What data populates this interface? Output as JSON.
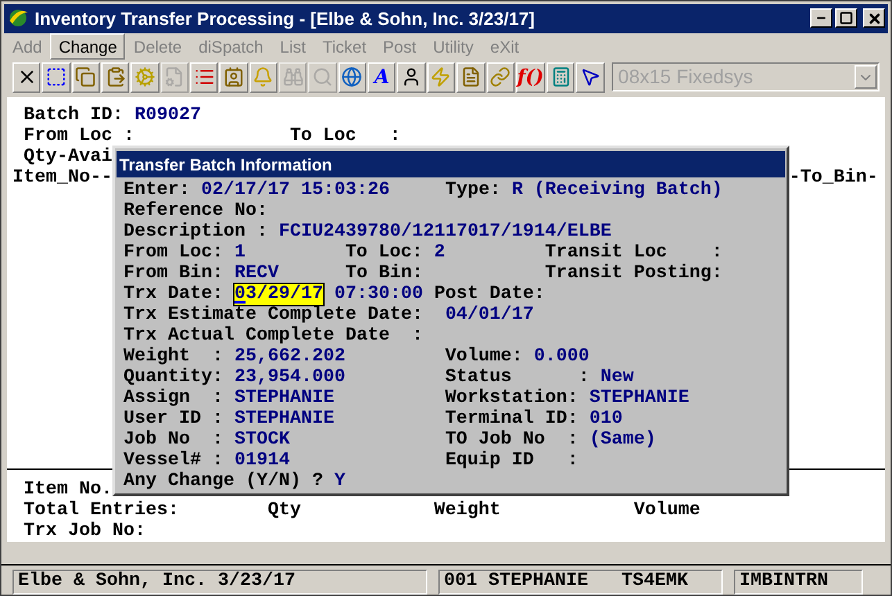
{
  "window": {
    "title": "Inventory Transfer Processing - [Elbe & Sohn, Inc. 3/23/17]"
  },
  "menu": [
    {
      "label": "Add",
      "disabled": true,
      "selected": false
    },
    {
      "label": "Change",
      "disabled": false,
      "selected": true
    },
    {
      "label": "Delete",
      "disabled": true,
      "selected": false
    },
    {
      "label": "diSpatch",
      "disabled": true,
      "selected": false
    },
    {
      "label": "List",
      "disabled": true,
      "selected": false
    },
    {
      "label": "Ticket",
      "disabled": true,
      "selected": false
    },
    {
      "label": "Post",
      "disabled": true,
      "selected": false
    },
    {
      "label": "Utility",
      "disabled": true,
      "selected": false
    },
    {
      "label": "eXit",
      "disabled": true,
      "selected": false
    }
  ],
  "toolbar": {
    "buttons": [
      {
        "kind": "icon",
        "disabled": false
      },
      {
        "kind": "icon",
        "disabled": false
      },
      {
        "kind": "icon",
        "disabled": false
      },
      {
        "kind": "icon",
        "disabled": false
      },
      {
        "kind": "icon",
        "disabled": false
      },
      {
        "kind": "icon",
        "disabled": true
      },
      {
        "kind": "icon",
        "disabled": false
      },
      {
        "kind": "icon",
        "disabled": false
      },
      {
        "kind": "icon",
        "disabled": false
      },
      {
        "kind": "icon",
        "disabled": true
      },
      {
        "kind": "icon",
        "disabled": true
      },
      {
        "kind": "icon",
        "disabled": false
      },
      {
        "kind": "glyph",
        "text": "A",
        "disabled": false
      },
      {
        "kind": "icon",
        "disabled": false
      },
      {
        "kind": "icon",
        "disabled": false
      },
      {
        "kind": "icon",
        "disabled": false
      },
      {
        "kind": "icon",
        "disabled": false
      },
      {
        "kind": "glyph",
        "text": "f()",
        "disabled": false
      },
      {
        "kind": "icon",
        "disabled": false
      },
      {
        "kind": "icon",
        "disabled": false
      }
    ],
    "font_select": {
      "value": "08x15 Fixedsys",
      "disabled": true
    }
  },
  "terminal": {
    "top_lines": [
      [
        {
          "kind": "label",
          "text": "Batch ID:"
        },
        {
          "kind": "value",
          "text": "R09027"
        }
      ],
      [
        {
          "kind": "label",
          "text": "From Loc :"
        },
        {
          "kind": "label",
          "text": "To Loc   :"
        }
      ],
      [
        {
          "kind": "label",
          "text": "Qty-Avai"
        }
      ],
      [
        {
          "kind": "label",
          "text": "Item_No--"
        },
        {
          "kind": "label",
          "text": "-To_Bin-"
        }
      ]
    ],
    "bottom_lines": [
      [
        {
          "kind": "label",
          "text": "Item No."
        }
      ],
      [
        {
          "kind": "label",
          "text": "Total Entries:"
        },
        {
          "kind": "label",
          "text": "Qty"
        },
        {
          "kind": "label",
          "text": "Weight"
        },
        {
          "kind": "label",
          "text": "Volume"
        }
      ],
      [
        {
          "kind": "label",
          "text": "Trx Job No:"
        }
      ]
    ]
  },
  "dialog": {
    "title": "Transfer Batch Information",
    "lines": [
      [
        {
          "kind": "label",
          "text": "Enter:"
        },
        {
          "kind": "value",
          "text": "02/17/17 15:03:26"
        },
        {
          "kind": "label",
          "text": "Type:"
        },
        {
          "kind": "value",
          "text": "R (Receiving Batch)"
        }
      ],
      [
        {
          "kind": "label",
          "text": "Reference No:"
        }
      ],
      [
        {
          "kind": "label",
          "text": "Description :"
        },
        {
          "kind": "value",
          "text": "FCIU2439780/12117017/1914/ELBE"
        }
      ],
      [
        {
          "kind": "label",
          "text": "From Loc:"
        },
        {
          "kind": "value",
          "text": "1"
        },
        {
          "kind": "label",
          "text": "To Loc:"
        },
        {
          "kind": "value",
          "text": "2"
        },
        {
          "kind": "label",
          "text": "Transit Loc    :"
        }
      ],
      [
        {
          "kind": "label",
          "text": "From Bin:"
        },
        {
          "kind": "value",
          "text": "RECV"
        },
        {
          "kind": "label",
          "text": "To Bin:"
        },
        {
          "kind": "label",
          "text": "Transit Posting:"
        }
      ],
      [
        {
          "kind": "label",
          "text": "Trx Date:"
        },
        {
          "kind": "input",
          "text": "03/29/17"
        },
        {
          "kind": "value",
          "text": "07:30:00"
        },
        {
          "kind": "label",
          "text": "Post Date:"
        }
      ],
      [
        {
          "kind": "label",
          "text": "Trx Estimate Complete Date:"
        },
        {
          "kind": "value",
          "text": "04/01/17"
        }
      ],
      [
        {
          "kind": "label",
          "text": "Trx Actual Complete Date  :"
        }
      ],
      [
        {
          "kind": "label",
          "text": "Weight  :"
        },
        {
          "kind": "value",
          "text": "25,662.202"
        },
        {
          "kind": "label",
          "text": "Volume:"
        },
        {
          "kind": "value",
          "text": "0.000"
        }
      ],
      [
        {
          "kind": "label",
          "text": "Quantity:"
        },
        {
          "kind": "value",
          "text": "23,954.000"
        },
        {
          "kind": "label",
          "text": "Status      :"
        },
        {
          "kind": "value",
          "text": "New"
        }
      ],
      [
        {
          "kind": "label",
          "text": "Assign  :"
        },
        {
          "kind": "value",
          "text": "STEPHANIE"
        },
        {
          "kind": "label",
          "text": "Workstation:"
        },
        {
          "kind": "value",
          "text": "STEPHANIE"
        }
      ],
      [
        {
          "kind": "label",
          "text": "User ID :"
        },
        {
          "kind": "value",
          "text": "STEPHANIE"
        },
        {
          "kind": "label",
          "text": "Terminal ID:"
        },
        {
          "kind": "value",
          "text": "010"
        }
      ],
      [
        {
          "kind": "label",
          "text": "Job No  :"
        },
        {
          "kind": "value",
          "text": "STOCK"
        },
        {
          "kind": "label",
          "text": "TO Job No  :"
        },
        {
          "kind": "value",
          "text": "(Same)"
        }
      ],
      [
        {
          "kind": "label",
          "text": "Vessel# :"
        },
        {
          "kind": "value",
          "text": "01914"
        },
        {
          "kind": "label",
          "text": "Equip ID   :"
        }
      ],
      [
        {
          "kind": "label",
          "text": "Any Change (Y/N) ?"
        },
        {
          "kind": "value",
          "text": "Y"
        }
      ]
    ]
  },
  "status_bar": [
    "Elbe & Sohn, Inc. 3/23/17",
    "001 STEPHANIE   TS4EMK",
    "IMBINTRN"
  ]
}
